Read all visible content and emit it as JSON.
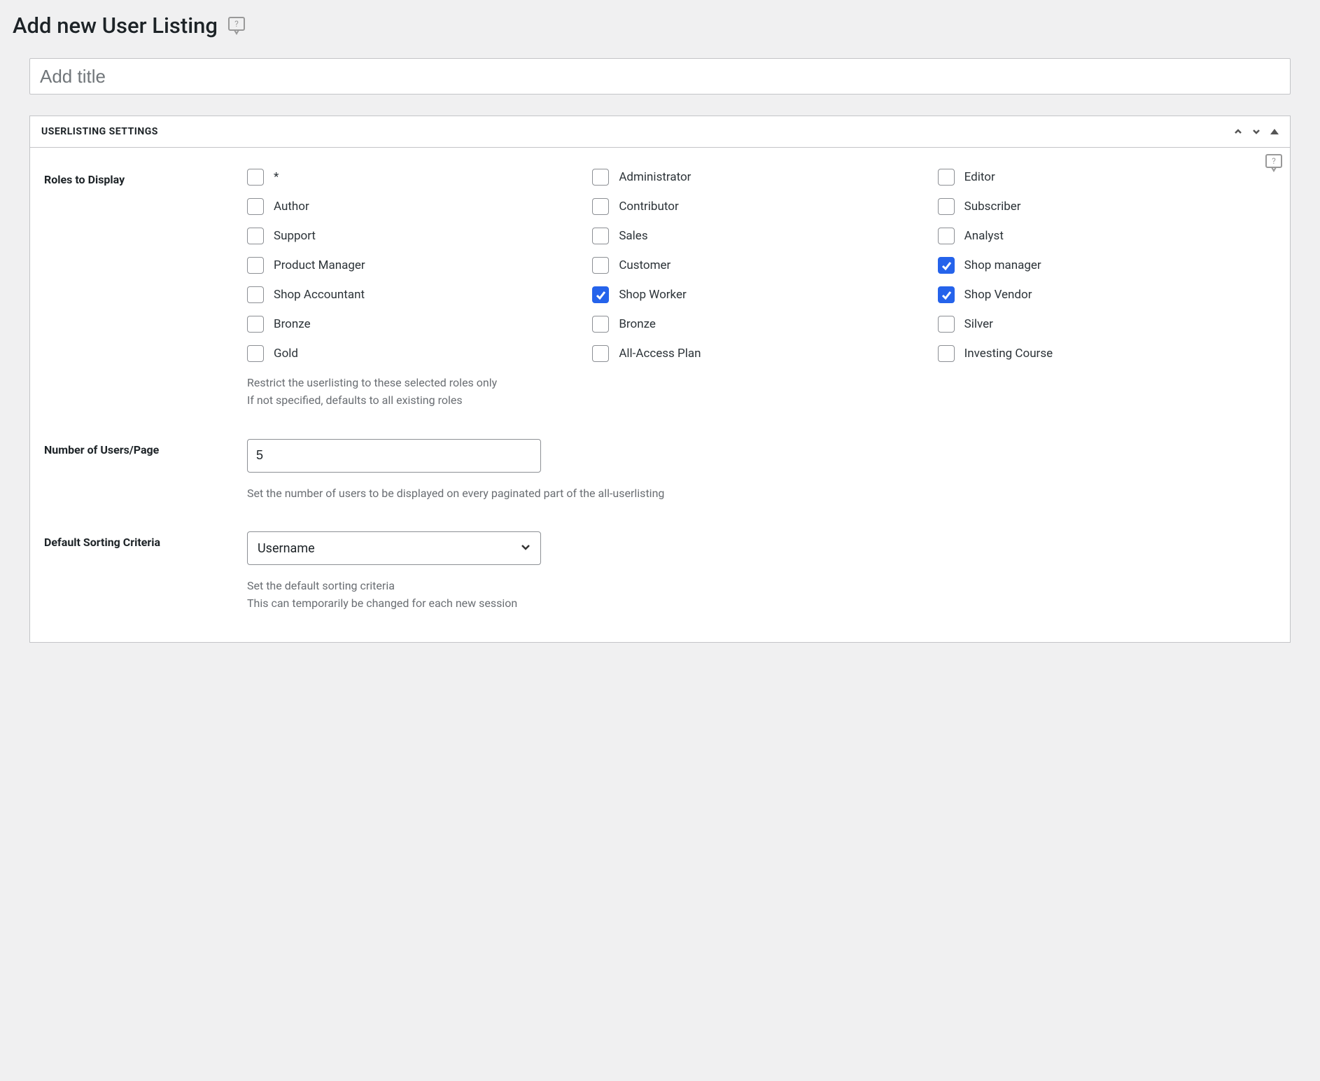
{
  "header": {
    "title": "Add new User Listing"
  },
  "title_field": {
    "placeholder": "Add title",
    "value": ""
  },
  "panel": {
    "title": "USERLISTING SETTINGS"
  },
  "settings": {
    "roles": {
      "label": "Roles to Display",
      "items": [
        {
          "label": "*",
          "checked": false
        },
        {
          "label": "Administrator",
          "checked": false
        },
        {
          "label": "Editor",
          "checked": false
        },
        {
          "label": "Author",
          "checked": false
        },
        {
          "label": "Contributor",
          "checked": false
        },
        {
          "label": "Subscriber",
          "checked": false
        },
        {
          "label": "Support",
          "checked": false
        },
        {
          "label": "Sales",
          "checked": false
        },
        {
          "label": "Analyst",
          "checked": false
        },
        {
          "label": "Product Manager",
          "checked": false
        },
        {
          "label": "Customer",
          "checked": false
        },
        {
          "label": "Shop manager",
          "checked": true
        },
        {
          "label": "Shop Accountant",
          "checked": false
        },
        {
          "label": "Shop Worker",
          "checked": true
        },
        {
          "label": "Shop Vendor",
          "checked": true
        },
        {
          "label": "Bronze",
          "checked": false
        },
        {
          "label": "Bronze",
          "checked": false
        },
        {
          "label": "Silver",
          "checked": false
        },
        {
          "label": "Gold",
          "checked": false
        },
        {
          "label": "All-Access Plan",
          "checked": false
        },
        {
          "label": "Investing Course",
          "checked": false
        }
      ],
      "help1": "Restrict the userlisting to these selected roles only",
      "help2": "If not specified, defaults to all existing roles"
    },
    "users_per_page": {
      "label": "Number of Users/Page",
      "value": "5",
      "help": "Set the number of users to be displayed on every paginated part of the all-userlisting"
    },
    "default_sort": {
      "label": "Default Sorting Criteria",
      "selected": "Username",
      "help1": "Set the default sorting criteria",
      "help2": "This can temporarily be changed for each new session"
    }
  }
}
